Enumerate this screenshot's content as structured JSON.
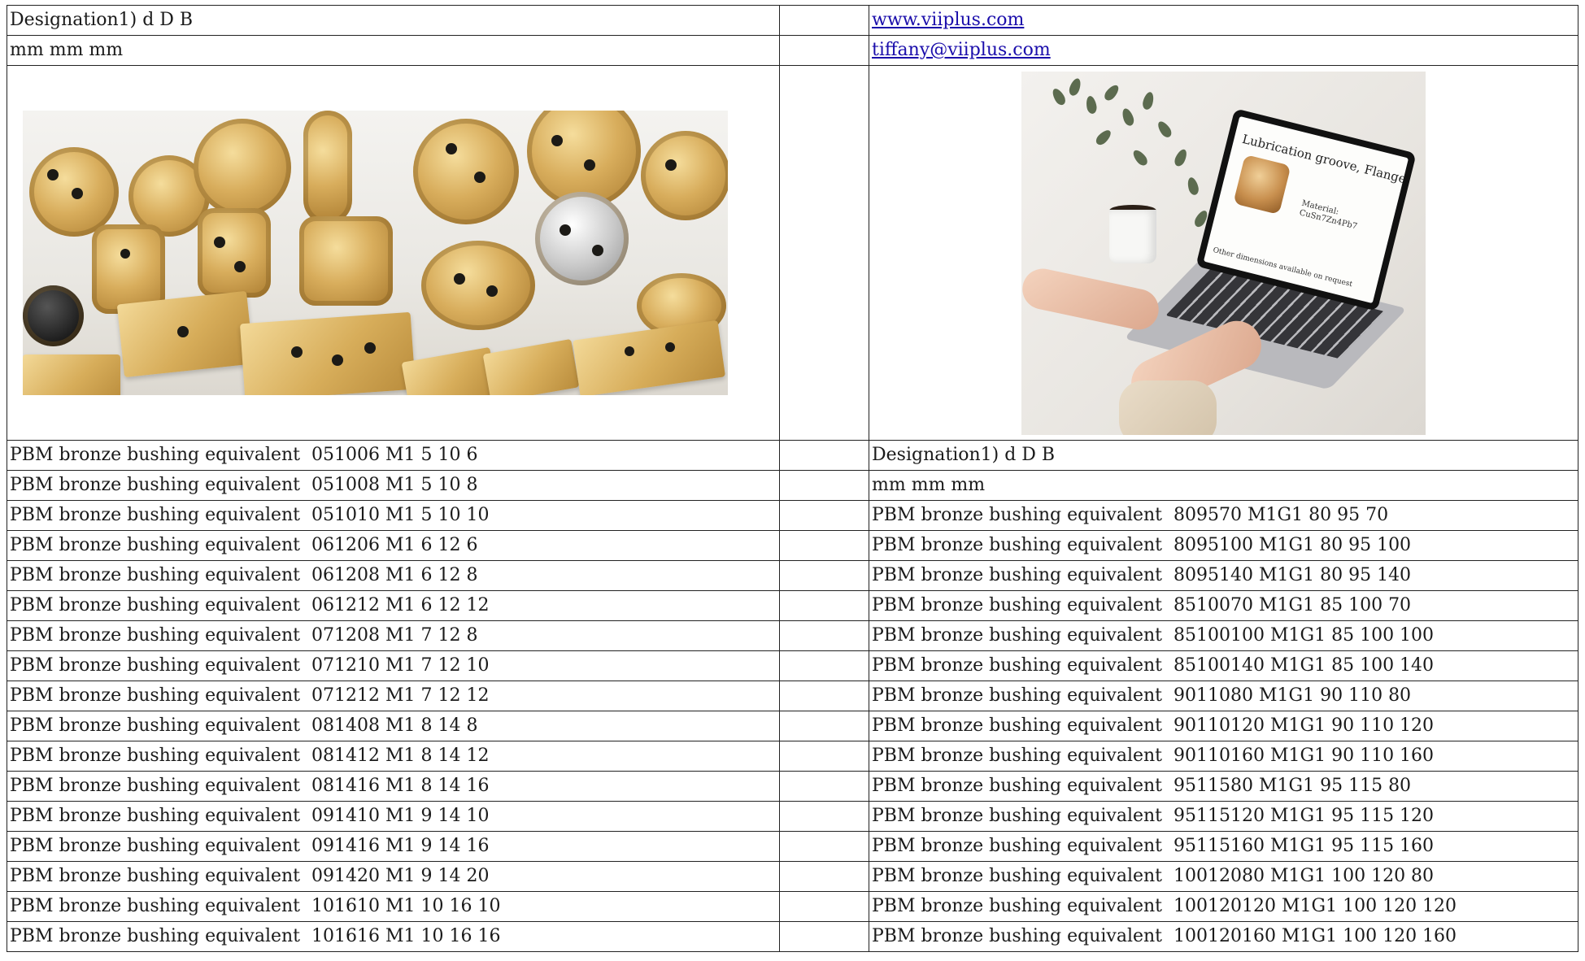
{
  "header_left": [
    "Designation1) d D B",
    "mm mm mm"
  ],
  "header_right": {
    "website": "www.viiplus.com",
    "email": "tiffany@viiplus.com"
  },
  "promo_image": {
    "title": "Lubrication groove, Flange Size",
    "material_label": "Material:",
    "material_value": "CuSn7Zn4Pb7",
    "note": "Other dimensions available on request"
  },
  "right_subheader": [
    "Designation1) d D B",
    "mm mm mm"
  ],
  "product_prefix": "PBM bronze bushing equivalent",
  "left_rows": [
    "051006 M1 5 10 6",
    "051008 M1 5 10 8",
    "051010 M1 5 10 10",
    "061206 M1 6 12 6",
    "061208 M1 6 12 8",
    "061212 M1 6 12 12",
    "071208 M1 7 12 8",
    "071210 M1 7 12 10",
    "071212 M1 7 12 12",
    "081408 M1 8 14 8",
    "081412 M1 8 14 12",
    "081416 M1 8 14 16",
    "091410 M1 9 14 10",
    "091416 M1 9 14 16",
    "091420 M1 9 14 20",
    "101610 M1 10 16 10",
    "101616 M1 10 16 16"
  ],
  "right_rows": [
    "809570 M1G1 80 95 70",
    "8095100 M1G1 80 95 100",
    "8095140 M1G1 80 95 140",
    "8510070 M1G1 85 100 70",
    "85100100 M1G1 85 100 100",
    "85100140 M1G1 85 100 140",
    "9011080 M1G1 90 110 80",
    "90110120 M1G1 90 110 120",
    "90110160 M1G1 90 110 160",
    "9511580 M1G1 95 115 80",
    "95115120 M1G1 95 115 120",
    "95115160 M1G1 95 115 160",
    "10012080 M1G1 100 120 80",
    "100120120 M1G1 100 120 120",
    "100120160 M1G1 100 120 160"
  ]
}
